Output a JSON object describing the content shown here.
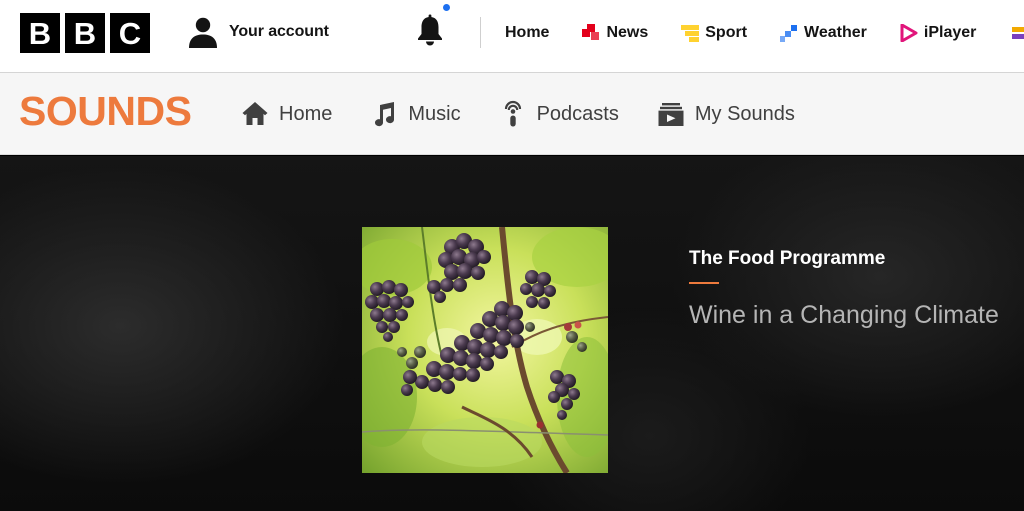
{
  "header": {
    "logo_letters": [
      "B",
      "B",
      "C"
    ],
    "account_label": "Your account",
    "notification_dot_color": "#1d70f0",
    "nav": [
      {
        "label": "Home",
        "icon": "none"
      },
      {
        "label": "News",
        "icon": "news-icon",
        "color": "#e3001b"
      },
      {
        "label": "Sport",
        "icon": "sport-icon",
        "color": "#ffd230"
      },
      {
        "label": "Weather",
        "icon": "weather-icon",
        "color": "#1d70f0"
      },
      {
        "label": "iPlayer",
        "icon": "iplayer-icon",
        "color": "#e1157b"
      }
    ]
  },
  "sounds": {
    "logo": "SOUNDS",
    "brand_color": "#ed7a3d",
    "nav": [
      {
        "label": "Home",
        "icon": "house-icon"
      },
      {
        "label": "Music",
        "icon": "music-note-icon"
      },
      {
        "label": "Podcasts",
        "icon": "podcast-icon"
      },
      {
        "label": "My Sounds",
        "icon": "my-sounds-icon"
      }
    ]
  },
  "hero": {
    "show_title": "The Food Programme",
    "episode_title": "Wine in a Changing Climate",
    "artwork_alt": "Grapes on a vine"
  }
}
